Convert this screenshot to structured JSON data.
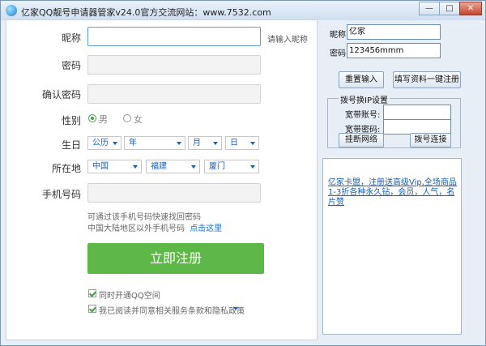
{
  "window": {
    "title": "亿家QQ靓号申请器管家v24.0官方交流网站：www.7532.com",
    "buttons": {
      "minimize": "—",
      "maximize": "□",
      "close": "✕"
    }
  },
  "form": {
    "nickname": {
      "label": "昵称",
      "value": "",
      "hint": "请输入昵称"
    },
    "password": {
      "label": "密码",
      "value": ""
    },
    "confirm_password": {
      "label": "确认密码",
      "value": ""
    },
    "gender": {
      "label": "性别",
      "male": "男",
      "female": "女",
      "selected": "男"
    },
    "birthday": {
      "label": "生日",
      "calendar": "公历",
      "year": "年",
      "month": "月",
      "day": "日"
    },
    "location": {
      "label": "所在地",
      "country": "中国",
      "province": "福建",
      "city": "厦门"
    },
    "phone": {
      "label": "手机号码",
      "value": "",
      "note1": "可通过该手机号码快速找回密码",
      "note2": "中国大陆地区以外手机号码",
      "note2_link": "点击这里"
    },
    "submit": "立即注册",
    "check_qzone": "同时开通QQ空间",
    "check_terms": "我已阅读并同意相关服务条款和隐私政策"
  },
  "right": {
    "nickname_label": "昵称:",
    "nickname_value": "亿家",
    "password_label": "密码:",
    "password_value": "123456mmm",
    "reset_button": "重置输入",
    "fill_button": "填写资料一键注册",
    "dialup": {
      "group_title": "拨号换IP设置",
      "account_label": "宽带账号:",
      "password_label": "宽带密码:",
      "account_value": "",
      "password_value": "",
      "disconnect_button": "挂断网络",
      "connect_button": "拨号连接"
    },
    "ad_text": "亿家卡盟，注册送高级Vip,全场商品1-3折各种永久钻，会员，人气，名片赞"
  },
  "colors": {
    "accent_green": "#5db848",
    "link_blue": "#1a6fd6"
  }
}
